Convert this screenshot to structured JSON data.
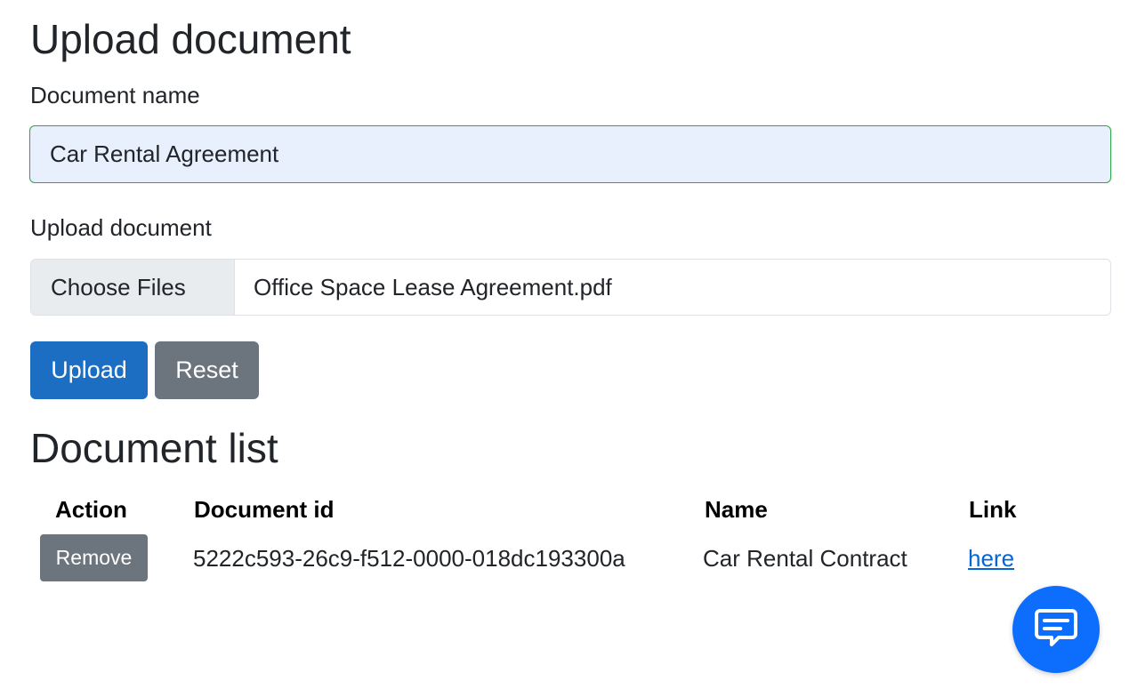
{
  "upload_section": {
    "title": "Upload document",
    "name_label": "Document name",
    "name_value": "Car Rental Agreement",
    "file_label": "Upload document",
    "file_button_label": "Choose Files",
    "file_selected": "Office Space Lease Agreement.pdf",
    "upload_button": "Upload",
    "reset_button": "Reset"
  },
  "list_section": {
    "title": "Document list",
    "columns": [
      "Action",
      "Document id",
      "Name",
      "Link"
    ],
    "rows": [
      {
        "action_label": "Remove",
        "document_id": "5222c593-26c9-f512-0000-018dc193300a",
        "name": "Car Rental Contract",
        "link_text": "here"
      }
    ]
  },
  "chat_widget": {
    "icon": "chat-bubble-icon"
  },
  "colors": {
    "primary": "#1b6ec2",
    "secondary": "#6c757d",
    "chat": "#0d6efd",
    "valid_border": "#28a745",
    "autofill_bg": "#e8f0fe",
    "link": "#0366d6"
  }
}
